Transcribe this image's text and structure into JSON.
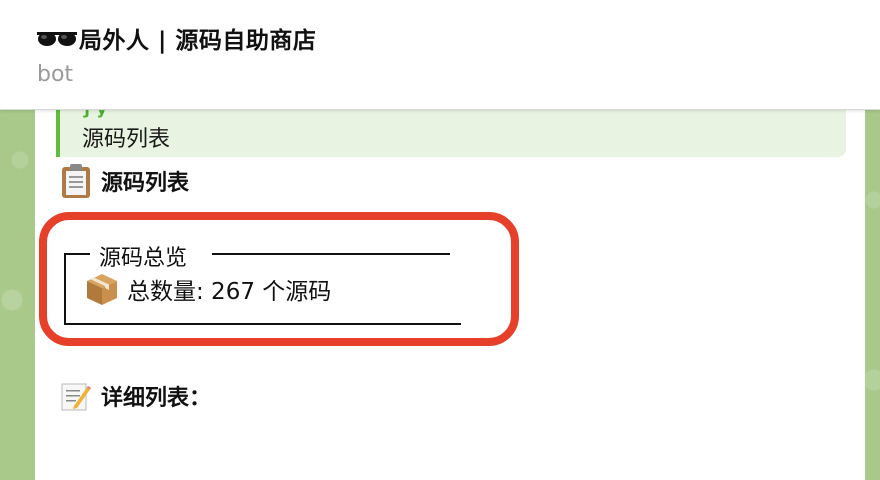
{
  "header": {
    "title": "局外人 | 源码自助商店",
    "subtitle": "bot",
    "title_icon": "sunglasses-icon"
  },
  "reply": {
    "sender": "ƒ y",
    "text": "源码列表"
  },
  "message": {
    "heading": "源码列表",
    "heading_icon": "clipboard-icon",
    "overview": {
      "title": "源码总览",
      "count_icon": "package-icon",
      "count_text": "总数量: 267 个源码"
    },
    "details_heading": "详细列表：",
    "details_icon": "memo-icon"
  },
  "colors": {
    "highlight": "#e6402a",
    "reply_accent": "#5cbf3d",
    "wallpaper": "#a8c98a"
  }
}
